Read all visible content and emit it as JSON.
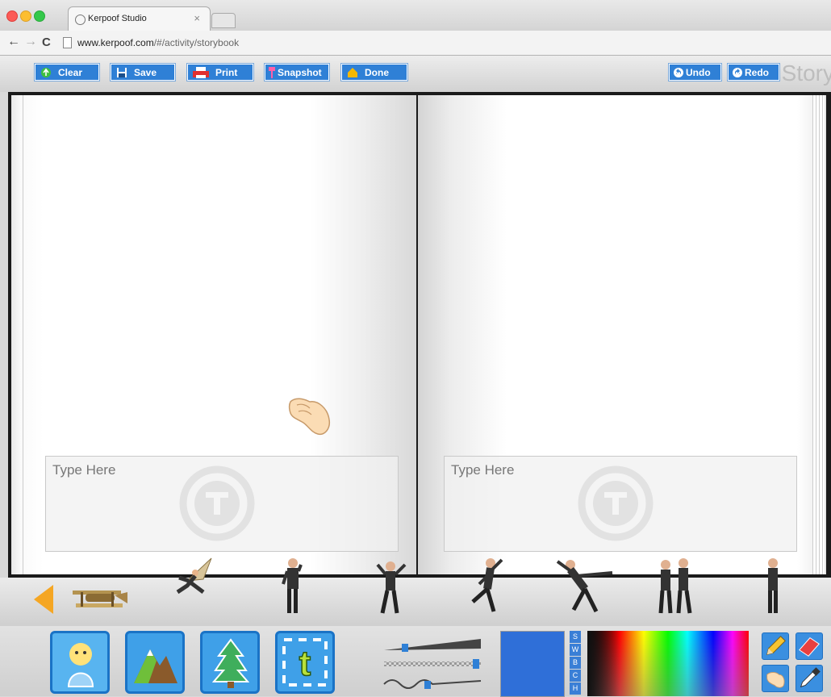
{
  "browser": {
    "tab_title": "Kerpoof Studio",
    "tab_close": "×",
    "url_domain": "www.kerpoof.com",
    "url_path": "/#/activity/storybook"
  },
  "toolbar": {
    "clear_label": "Clear",
    "save_label": "Save",
    "print_label": "Print",
    "snapshot_label": "Snapshot",
    "done_label": "Done",
    "undo_label": "Undo",
    "redo_label": "Redo",
    "app_title": "Story"
  },
  "book": {
    "left_textbox_placeholder": "Type Here",
    "right_textbox_placeholder": "Type Here"
  },
  "color_panel": {
    "selected_color": "#2f6fd8",
    "side_tabs": [
      "S",
      "W",
      "B",
      "C",
      "H"
    ]
  },
  "colors": {
    "button_blue": "#2f80d6",
    "arrow_orange": "#f5a623"
  }
}
